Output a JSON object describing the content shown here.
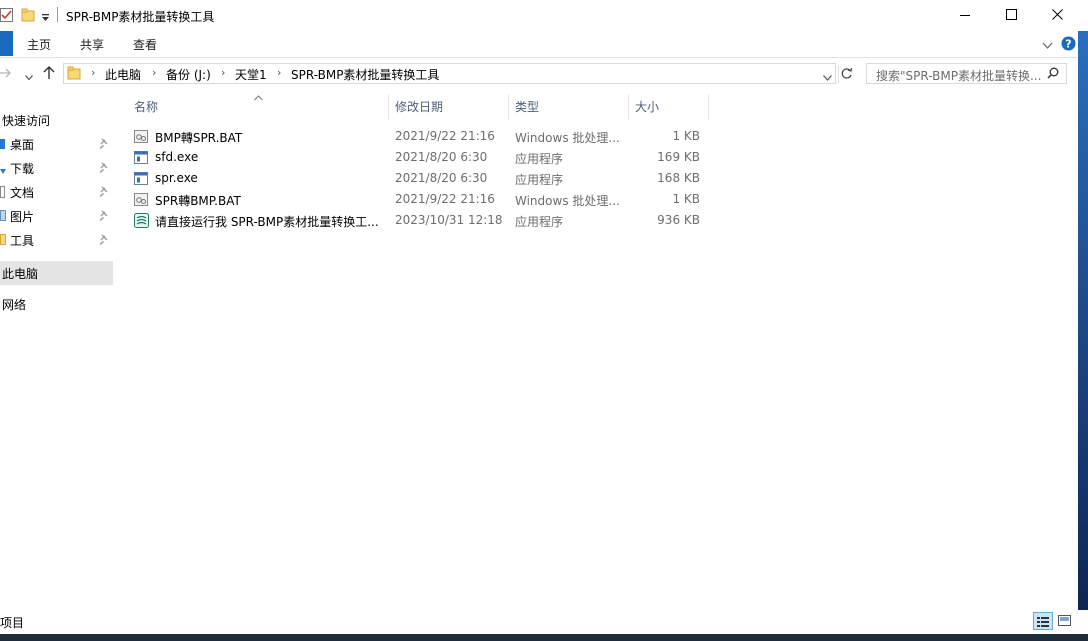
{
  "window": {
    "title": "SPR-BMP素材批量转换工具"
  },
  "ribbon": {
    "tabs": [
      "主页",
      "共享",
      "查看"
    ]
  },
  "address": {
    "crumbs": [
      "此电脑",
      "备份 (J:)",
      "天堂1",
      "SPR-BMP素材批量转换工具"
    ]
  },
  "search": {
    "placeholder": "搜索\"SPR-BMP素材批量转换..."
  },
  "nav": {
    "quick_access": "快速访问",
    "pinned": [
      "桌面",
      "下载",
      "文档",
      "图片",
      "工具"
    ],
    "this_pc": "此电脑",
    "network": "网络"
  },
  "columns": {
    "name": "名称",
    "date": "修改日期",
    "type": "类型",
    "size": "大小"
  },
  "files": [
    {
      "name": "BMP轉SPR.BAT",
      "date": "2021/9/22 21:16",
      "type": "Windows 批处理...",
      "size": "1 KB",
      "icon": "bat-icon"
    },
    {
      "name": "sfd.exe",
      "date": "2021/8/20 6:30",
      "type": "应用程序",
      "size": "169 KB",
      "icon": "exe-icon"
    },
    {
      "name": "spr.exe",
      "date": "2021/8/20 6:30",
      "type": "应用程序",
      "size": "168 KB",
      "icon": "exe-icon"
    },
    {
      "name": "SPR轉BMP.BAT",
      "date": "2021/9/22 21:16",
      "type": "Windows 批处理...",
      "size": "1 KB",
      "icon": "bat-icon"
    },
    {
      "name": "请直接运行我 SPR-BMP素材批量转换工...",
      "date": "2023/10/31 12:18",
      "type": "应用程序",
      "size": "936 KB",
      "icon": "app-icon"
    }
  ],
  "status": {
    "items_label": "项目"
  },
  "colors": {
    "accent": "#1a6bbf",
    "selection": "#e5e5e5",
    "header_text": "#4c607a",
    "folder": "#f8d775"
  }
}
